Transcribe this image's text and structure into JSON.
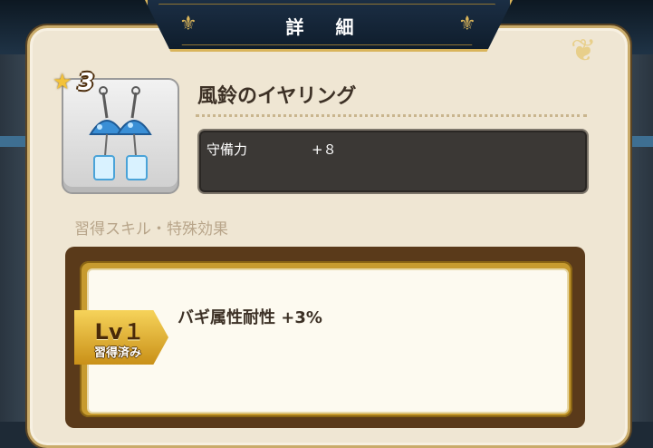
{
  "header": {
    "title": "詳 細"
  },
  "item": {
    "rarity": "3",
    "name": "風鈴のイヤリング",
    "icon": "earring-icon"
  },
  "stats": [
    {
      "label": "守備力",
      "value": "+８"
    }
  ],
  "skills": {
    "section_title": "習得スキル・特殊効果",
    "entries": [
      {
        "level": "Lv１",
        "status": "習得済み",
        "text": "バギ属性耐性 +3%"
      }
    ]
  },
  "colors": {
    "title_bar": "#0f1d2c",
    "gold_trim": "#d9b45a",
    "panel_bg": "#efe6d3",
    "stat_box": "#3b3835",
    "badge_gold": "#f6d35a"
  }
}
